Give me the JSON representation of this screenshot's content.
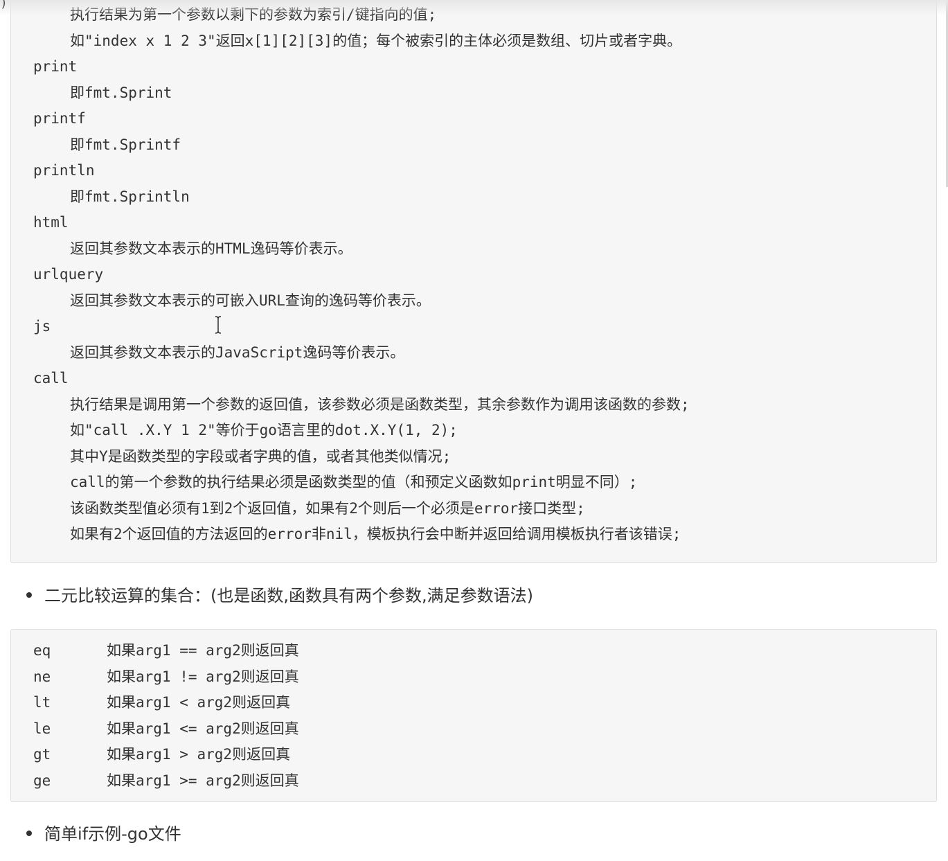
{
  "corner_glyph": ")",
  "functions_block": {
    "lines": [
      {
        "text": "执行结果为第一个参数以剩下的参数为索引/键指向的值;",
        "indent": true
      },
      {
        "text": "如\"index x 1 2 3\"返回x[1][2][3]的值；每个被索引的主体必须是数组、切片或者字典。",
        "indent": true
      },
      {
        "text": "print",
        "indent": false
      },
      {
        "text": "即fmt.Sprint",
        "indent": true
      },
      {
        "text": "printf",
        "indent": false
      },
      {
        "text": "即fmt.Sprintf",
        "indent": true
      },
      {
        "text": "println",
        "indent": false
      },
      {
        "text": "即fmt.Sprintln",
        "indent": true
      },
      {
        "text": "html",
        "indent": false
      },
      {
        "text": "返回其参数文本表示的HTML逸码等价表示。",
        "indent": true
      },
      {
        "text": "urlquery",
        "indent": false
      },
      {
        "text": "返回其参数文本表示的可嵌入URL查询的逸码等价表示。",
        "indent": true
      },
      {
        "text": "js",
        "indent": false
      },
      {
        "text": "返回其参数文本表示的JavaScript逸码等价表示。",
        "indent": true
      },
      {
        "text": "call",
        "indent": false
      },
      {
        "text": "执行结果是调用第一个参数的返回值，该参数必须是函数类型，其余参数作为调用该函数的参数;",
        "indent": true
      },
      {
        "text": "如\"call .X.Y 1 2\"等价于go语言里的dot.X.Y(1, 2);",
        "indent": true
      },
      {
        "text": "其中Y是函数类型的字段或者字典的值，或者其他类似情况;",
        "indent": true
      },
      {
        "text": "call的第一个参数的执行结果必须是函数类型的值（和预定义函数如print明显不同）;",
        "indent": true
      },
      {
        "text": "该函数类型值必须有1到2个返回值，如果有2个则后一个必须是error接口类型;",
        "indent": true
      },
      {
        "text": "如果有2个返回值的方法返回的error非nil，模板执行会中断并返回给调用模板执行者该错误;",
        "indent": true
      }
    ]
  },
  "bullet_comparison": "二元比较运算的集合：(也是函数,函数具有两个参数,满足参数语法)",
  "comparison_block": {
    "rows": [
      {
        "op": "eq",
        "desc": "如果arg1 == arg2则返回真"
      },
      {
        "op": "ne",
        "desc": "如果arg1 != arg2则返回真"
      },
      {
        "op": "lt",
        "desc": "如果arg1 < arg2则返回真"
      },
      {
        "op": "le",
        "desc": "如果arg1 <= arg2则返回真"
      },
      {
        "op": "gt",
        "desc": "如果arg1 > arg2则返回真"
      },
      {
        "op": "ge",
        "desc": "如果arg1 >= arg2则返回真"
      }
    ]
  },
  "bullet_if_example": "简单if示例-go文件"
}
